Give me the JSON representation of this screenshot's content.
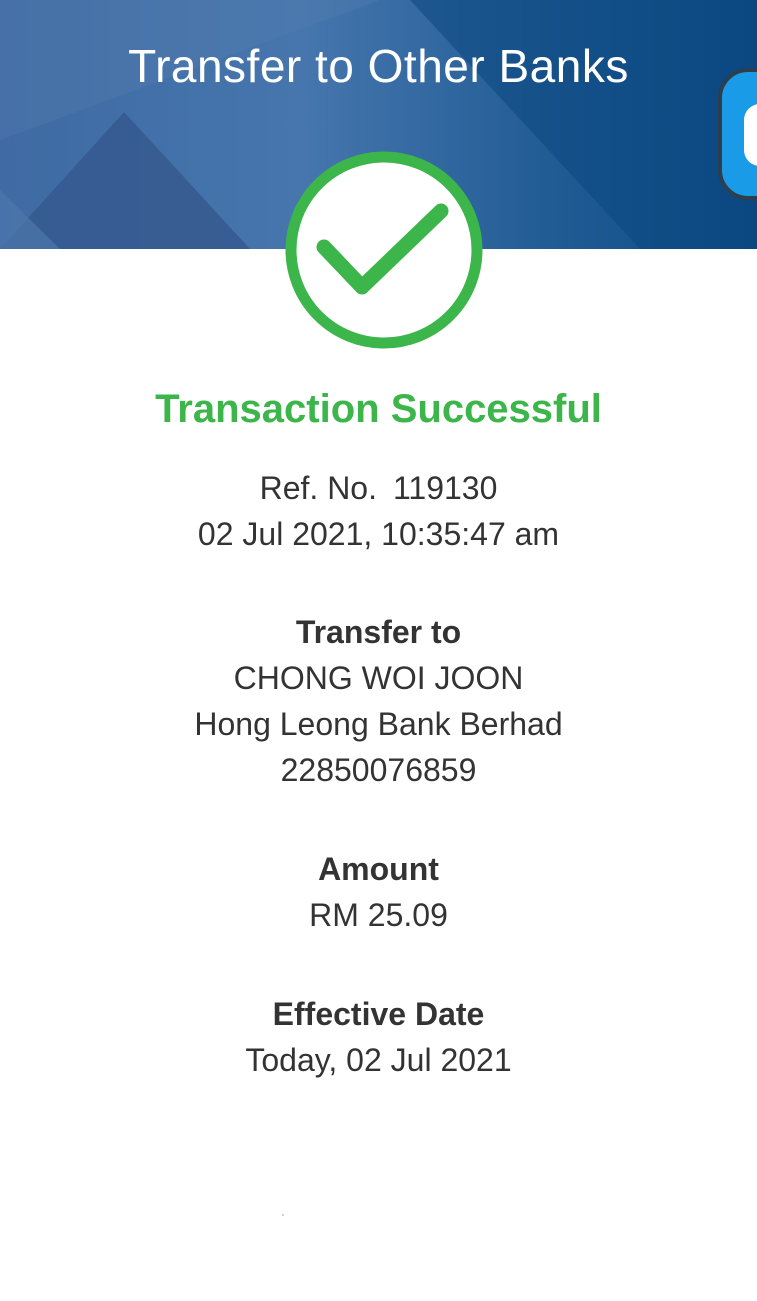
{
  "header": {
    "title": "Transfer to Other Banks"
  },
  "status": {
    "title": "Transaction Successful",
    "icon": "check-circle-icon",
    "color": "#3cb54a"
  },
  "reference": {
    "label": "Ref. No.",
    "number": "119130",
    "datetime": "02 Jul 2021, 10:35:47 am"
  },
  "transfer_to": {
    "label": "Transfer to",
    "name": "CHONG WOI JOON",
    "bank": "Hong Leong Bank Berhad",
    "account": "22850076859"
  },
  "amount": {
    "label": "Amount",
    "value": "RM 25.09"
  },
  "effective_date": {
    "label": "Effective Date",
    "value": "Today, 02 Jul 2021"
  },
  "colors": {
    "header_blue": "#1f5a93",
    "text": "#333333",
    "widget_blue": "#1a9be8"
  }
}
